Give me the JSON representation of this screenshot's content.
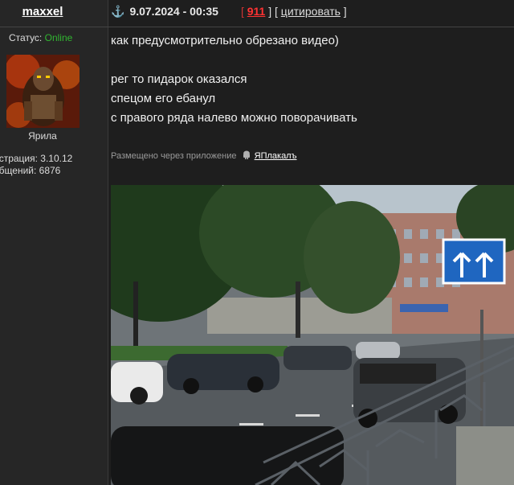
{
  "user": {
    "name": "maxxel",
    "status_label": "Статус:",
    "status_value": "Online",
    "rank": "Ярила",
    "registration": "истрация: 3.10.12",
    "posts": "общений: 6876"
  },
  "post": {
    "anchor": "⚓",
    "date": "9.07.2024 - 00:35",
    "rating_open": "[",
    "rating": "911",
    "rating_close": "]",
    "quote_open": "[",
    "quote": "цитировать",
    "quote_close": "]",
    "lines": [
      "как предусмотрительно обрезано видео)",
      "рег то пидарок оказался",
      "спецом его ебанул",
      "с правого ряда налево можно поворачивать"
    ],
    "via_text": "Размещено через приложение",
    "via_app": "ЯПлакалъ"
  },
  "colors": {
    "online": "#31b531",
    "rating": "#ff3333",
    "background": "#1e1e1e"
  }
}
